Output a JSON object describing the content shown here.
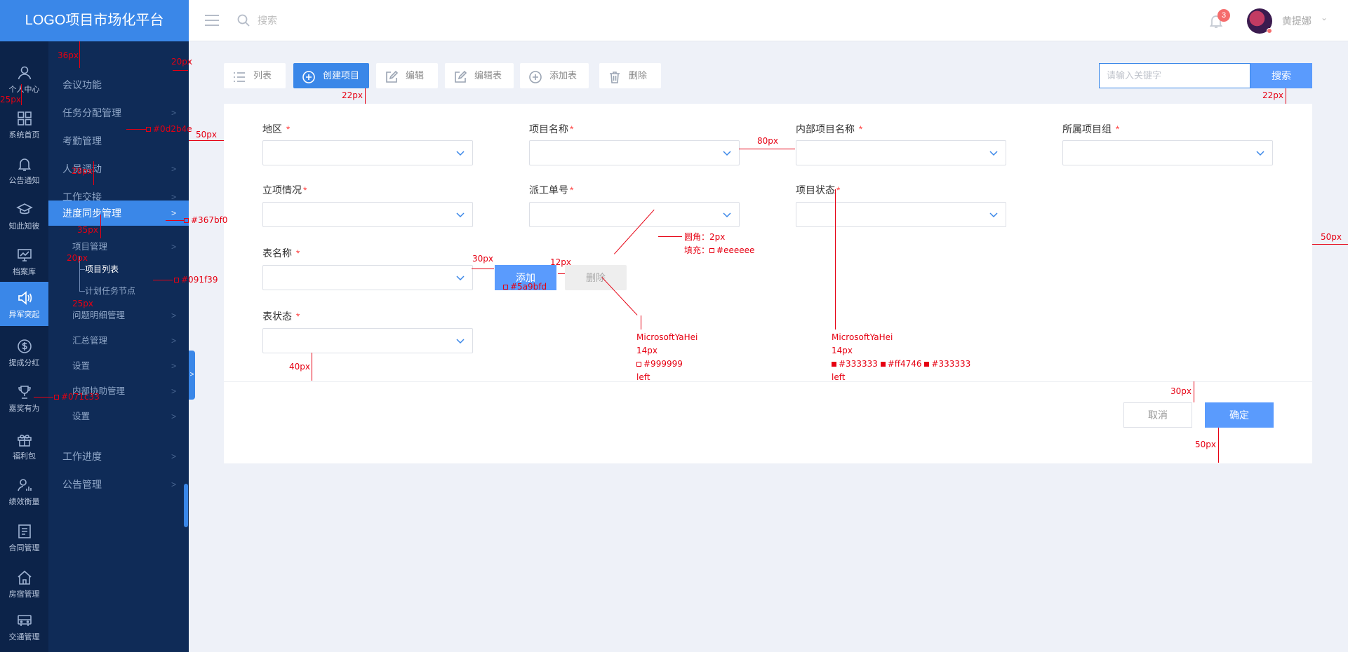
{
  "logo": "LOGO项目市场化平台",
  "iconbar": [
    {
      "label": "个人中心",
      "icon": "user-icon"
    },
    {
      "label": "系统首页",
      "icon": "grid-icon"
    },
    {
      "label": "公告通知",
      "icon": "bell-icon"
    },
    {
      "label": "知此知彼",
      "icon": "graduation-cap-icon"
    },
    {
      "label": "档案库",
      "icon": "monitor-chart-icon"
    },
    {
      "label": "异军突起",
      "icon": "speaker-icon",
      "active": true
    },
    {
      "label": "提成分红",
      "icon": "dollar-icon"
    },
    {
      "label": "嘉奖有为",
      "icon": "trophy-icon"
    },
    {
      "label": "福利包",
      "icon": "gift-icon"
    },
    {
      "label": "绩效衡量",
      "icon": "user-chart-icon"
    },
    {
      "label": "合同管理",
      "icon": "contract-icon"
    },
    {
      "label": "房宿管理",
      "icon": "house-icon"
    },
    {
      "label": "交通管理",
      "icon": "bus-icon"
    }
  ],
  "subnav": {
    "items": [
      "会议功能",
      "任务分配管理",
      "考勤管理",
      "人员调动",
      "工作交接",
      "进度同步管理"
    ],
    "active": "进度同步管理",
    "sub": {
      "project_mgmt": "项目管理",
      "project_list": "项目列表",
      "plan_node": "计划任务节点",
      "issue_mgmt": "问题明细管理",
      "summary_mgmt": "汇总管理",
      "settings1": "设置",
      "internal_mgmt": "内部协助管理",
      "settings2": "设置"
    },
    "bottom": [
      "工作进度",
      "公告管理"
    ]
  },
  "topbar": {
    "search_placeholder": "搜索",
    "notification_count": "3",
    "username": "黄提娜"
  },
  "toolbar": {
    "list": "列表",
    "create": "创建项目",
    "edit": "编辑",
    "edit_table": "编辑表",
    "add_table": "添加表",
    "delete": "删除",
    "keyword_placeholder": "请输入关键字",
    "search": "搜索"
  },
  "form": {
    "region": "地区",
    "project_name": "项目名称",
    "internal_name": "内部项目名称",
    "project_group": "所属项目组",
    "approval": "立项情况",
    "dispatch_no": "派工单号",
    "project_status": "项目状态",
    "table_name": "表名称",
    "table_status": "表状态",
    "required_mark": "*",
    "add": "添加",
    "delete": "删除",
    "cancel": "取消",
    "confirm": "确定"
  },
  "annotations": {
    "a36": "36px",
    "a20a": "20px",
    "a25a": "25px",
    "a0d": "#0d2b4e",
    "a50a": "50px",
    "a28": "28px",
    "a367": "#367bf0",
    "a35": "35px",
    "a20b": "20px",
    "a091": "#091f39",
    "a25b": "25px",
    "a071": "#071c33",
    "a22a": "22px",
    "a22b": "22px",
    "a80": "80px",
    "a30a": "30px",
    "a12": "12px",
    "a5a9": "#5a9bfd",
    "radius": "圆角：2px",
    "fill": "填充：",
    "fill_color": "#eeeeee",
    "font1_name": "MicrosoftYaHei",
    "font1_size": "14px",
    "font1_color": "#999999",
    "font1_align": "left",
    "font2_name": "MicrosoftYaHei",
    "font2_size": "14px",
    "font2_c1": "#333333",
    "font2_c2": "#ff4746",
    "font2_c3": "#333333",
    "font2_align": "left",
    "a40": "40px",
    "a50b": "50px",
    "a30b": "30px",
    "a50c": "50px",
    "colors": {
      "primary": "#3a87e8",
      "button": "#5a9bfd",
      "required": "#ff4746",
      "annotation": "#e60012"
    }
  }
}
